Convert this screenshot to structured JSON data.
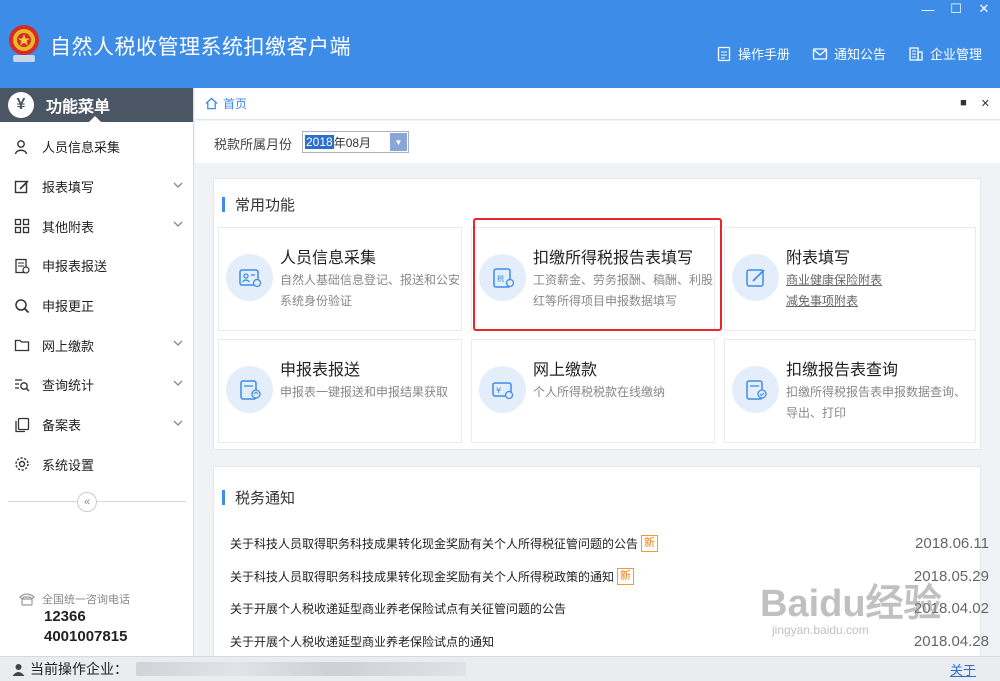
{
  "app": {
    "title": "自然人税收管理系统扣缴客户端",
    "top_nav": [
      {
        "label": "操作手册",
        "icon": "manual-icon"
      },
      {
        "label": "通知公告",
        "icon": "mail-icon"
      },
      {
        "label": "企业管理",
        "icon": "building-icon"
      }
    ]
  },
  "sidebar": {
    "header": "功能菜单",
    "items": [
      {
        "label": "人员信息采集",
        "icon": "person-icon",
        "expandable": false
      },
      {
        "label": "报表填写",
        "icon": "edit-icon",
        "expandable": true
      },
      {
        "label": "其他附表",
        "icon": "grid-icon",
        "expandable": true
      },
      {
        "label": "申报表报送",
        "icon": "report-send-icon",
        "expandable": false
      },
      {
        "label": "申报更正",
        "icon": "search-icon",
        "expandable": false
      },
      {
        "label": "网上缴款",
        "icon": "folder-icon",
        "expandable": true
      },
      {
        "label": "查询统计",
        "icon": "query-icon",
        "expandable": true
      },
      {
        "label": "备案表",
        "icon": "copy-icon",
        "expandable": true
      },
      {
        "label": "系统设置",
        "icon": "gear-icon",
        "expandable": false
      }
    ],
    "collapse": "«",
    "hotline_label": "全国统一咨询电话",
    "hotline_1": "12366",
    "hotline_2": "4001007815"
  },
  "breadcrumb": {
    "home": "首页"
  },
  "month": {
    "label": "税款所属月份",
    "year_part": "2018",
    "rest": "年08月"
  },
  "common": {
    "title": "常用功能",
    "cards": [
      {
        "title": "人员信息采集",
        "desc": "自然人基础信息登记、报送和公安系统身份验证"
      },
      {
        "title": "扣缴所得税报告表填写",
        "desc": "工资薪金、劳务报酬、稿酬、利股红等所得项目申报数据填写"
      },
      {
        "title": "附表填写",
        "links": [
          "商业健康保险附表",
          "减免事项附表"
        ]
      },
      {
        "title": "申报表报送",
        "desc": "申报表一键报送和申报结果获取"
      },
      {
        "title": "网上缴款",
        "desc": "个人所得税税款在线缴纳"
      },
      {
        "title": "扣缴报告表查询",
        "desc": "扣缴所得税报告表申报数据查询、导出、打印"
      }
    ]
  },
  "notices": {
    "title": "税务通知",
    "new_label": "新",
    "items": [
      {
        "text": "关于科技人员取得职务科技成果转化现金奖励有关个人所得税征管问题的公告",
        "is_new": true,
        "date": "2018.06.11"
      },
      {
        "text": "关于科技人员取得职务科技成果转化现金奖励有关个人所得税政策的通知",
        "is_new": true,
        "date": "2018.05.29"
      },
      {
        "text": "关于开展个人税收递延型商业养老保险试点有关征管问题的公告",
        "is_new": false,
        "date": "2018.04.02"
      },
      {
        "text": "关于开展个人税收递延型商业养老保险试点的通知",
        "is_new": false,
        "date": "2018.04.28"
      }
    ]
  },
  "status": {
    "label": "当前操作企业：",
    "about": "关于"
  },
  "watermark": {
    "brand": "Baidu经验",
    "url": "jingyan.baidu.com"
  },
  "colors": {
    "primary": "#3d8ce8",
    "sidebar_header": "#4a5663",
    "highlight": "#e5262d",
    "new_badge": "#f28020"
  }
}
